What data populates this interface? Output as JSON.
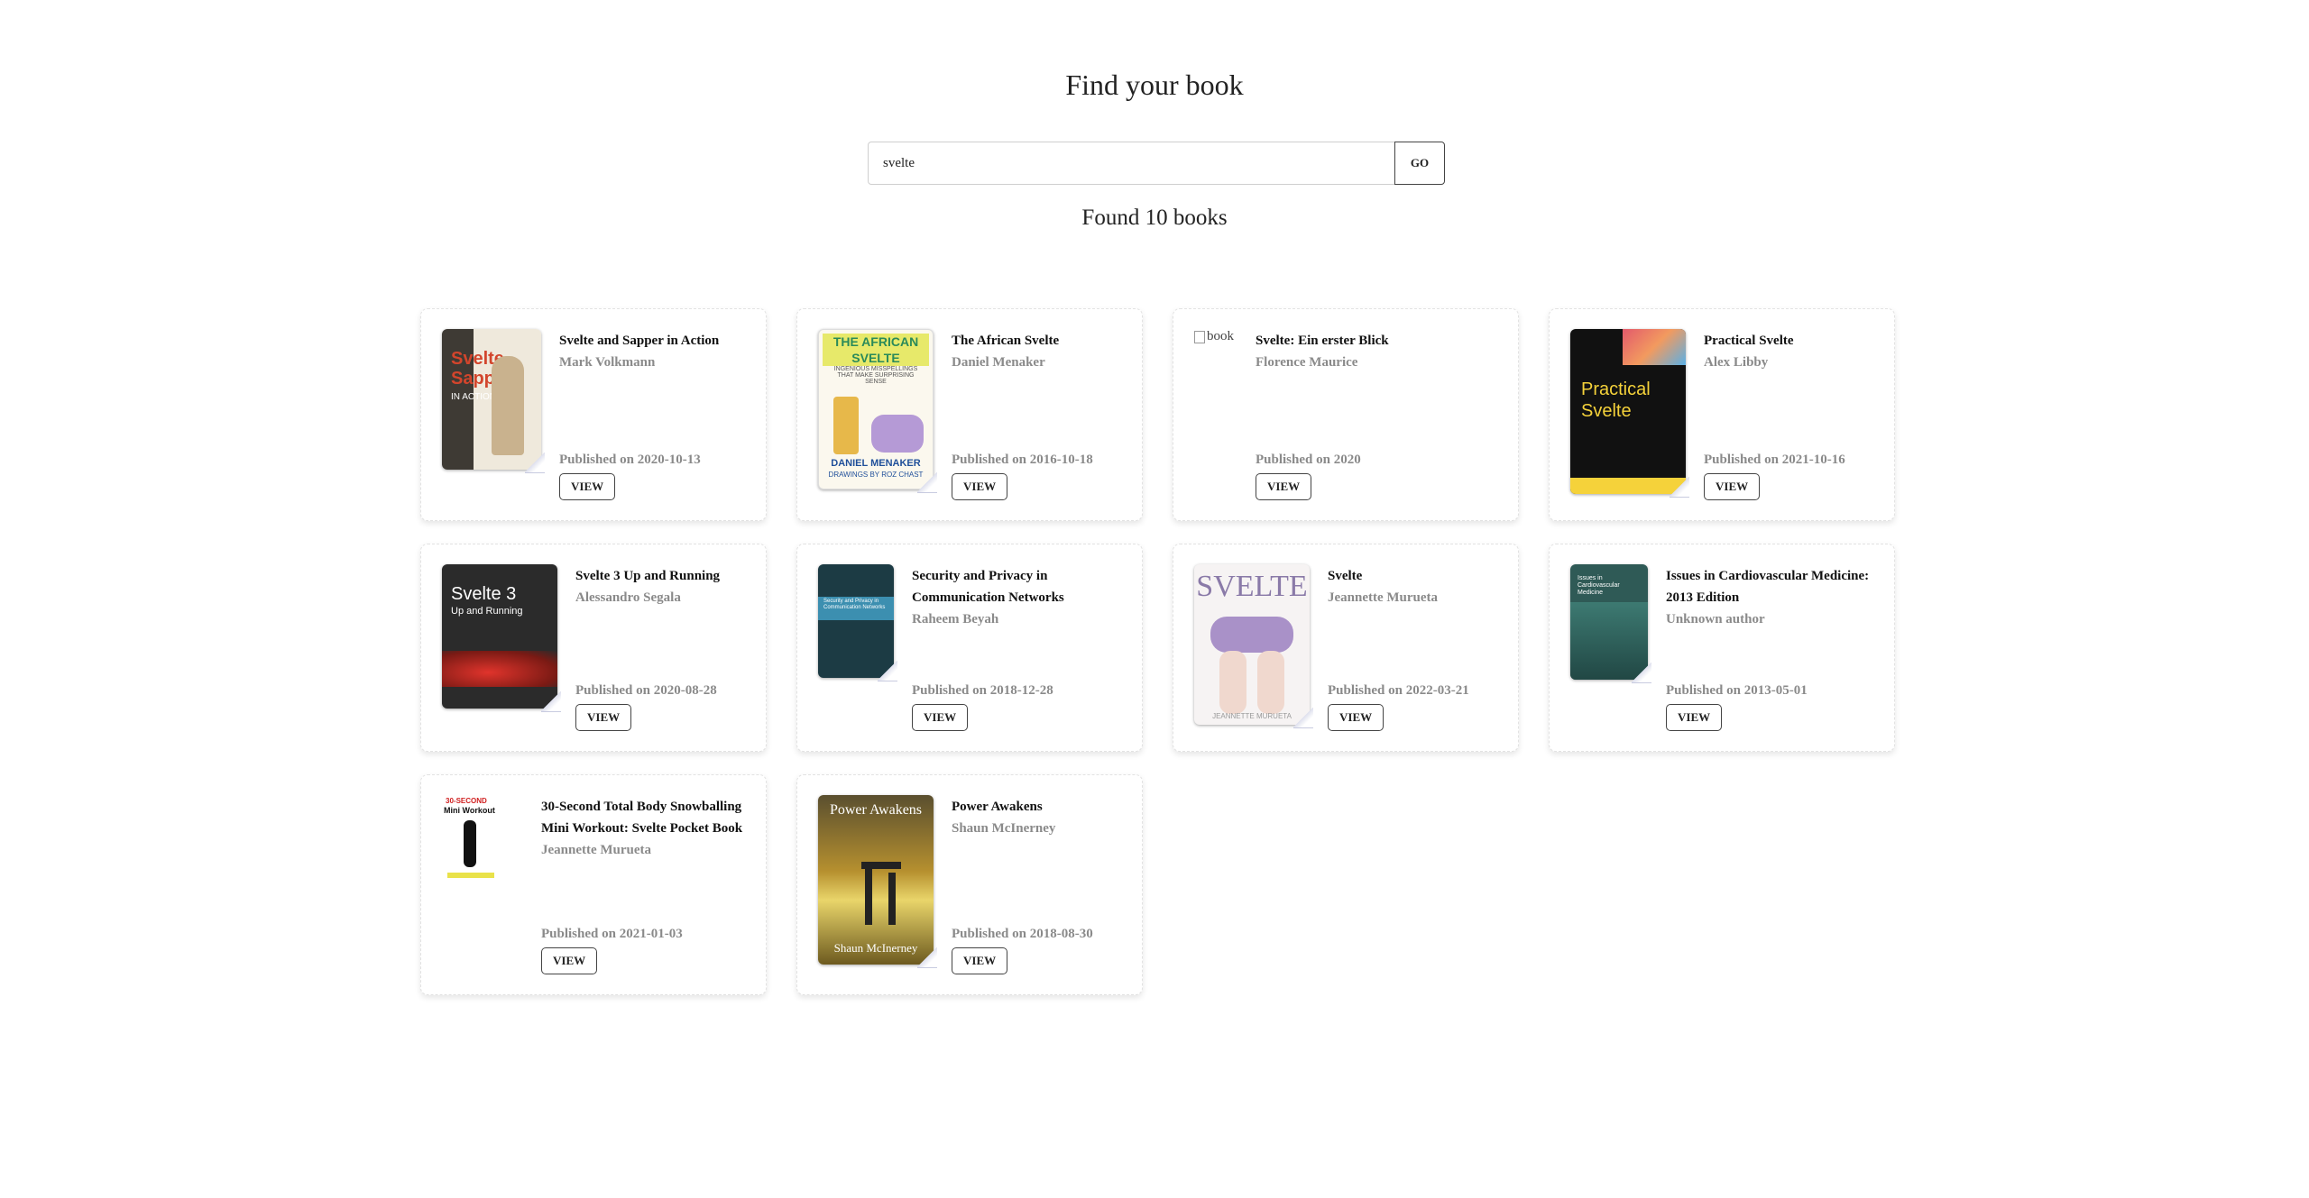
{
  "heading": "Find your book",
  "search": {
    "value": "svelte",
    "go_label": "GO"
  },
  "results_count": "Found 10 books",
  "books": [
    {
      "title": "Svelte and Sapper in Action",
      "author": "Mark Volkmann",
      "published": "Published on 2020-10-13",
      "view_label": "VIEW",
      "cover_text": [
        "Svelte",
        "Sapper",
        "IN ACTION"
      ]
    },
    {
      "title": "The African Svelte",
      "author": "Daniel Menaker",
      "published": "Published on 2016-10-18",
      "view_label": "VIEW",
      "cover_text": [
        "THE AFRICAN SVELTE",
        "INGENIOUS MISSPELLINGS THAT MAKE SURPRISING SENSE",
        "DANIEL MENAKER",
        "DRAWINGS BY ROZ CHAST"
      ]
    },
    {
      "title": "Svelte: Ein erster Blick",
      "author": "Florence Maurice",
      "published": "Published on 2020",
      "view_label": "VIEW",
      "cover_alt": "book"
    },
    {
      "title": "Practical Svelte",
      "author": "Alex Libby",
      "published": "Published on 2021-10-16",
      "view_label": "VIEW",
      "cover_text": [
        "Practical",
        "Svelte"
      ]
    },
    {
      "title": "Svelte 3 Up and Running",
      "author": "Alessandro Segala",
      "published": "Published on 2020-08-28",
      "view_label": "VIEW",
      "cover_text": [
        "Svelte 3",
        "Up and Running"
      ]
    },
    {
      "title": "Security and Privacy in Communication Networks",
      "author": "Raheem Beyah",
      "published": "Published on 2018-12-28",
      "view_label": "VIEW",
      "cover_text": [
        "Security and Privacy in Communication Networks"
      ]
    },
    {
      "title": "Svelte",
      "author": "Jeannette Murueta",
      "published": "Published on 2022-03-21",
      "view_label": "VIEW",
      "cover_text": [
        "SVELTE",
        "JEANNETTE MURUETA"
      ]
    },
    {
      "title": "Issues in Cardiovascular Medicine: 2013 Edition",
      "author": "Unknown author",
      "published": "Published on 2013-05-01",
      "view_label": "VIEW",
      "cover_text": [
        "Issues in Cardiovascular Medicine"
      ]
    },
    {
      "title": "30-Second Total Body Snowballing Mini Workout: Svelte Pocket Book",
      "author": "Jeannette Murueta",
      "published": "Published on 2021-01-03",
      "view_label": "VIEW",
      "cover_text": [
        "30-SECOND",
        "Mini Workout"
      ]
    },
    {
      "title": "Power Awakens",
      "author": "Shaun McInerney",
      "published": "Published on 2018-08-30",
      "view_label": "VIEW",
      "cover_text": [
        "Power Awakens",
        "Shaun McInerney"
      ]
    }
  ],
  "colors": {
    "card_border": "#e2e2e2",
    "muted_text": "#8a8a8a",
    "title_text": "#111111"
  }
}
